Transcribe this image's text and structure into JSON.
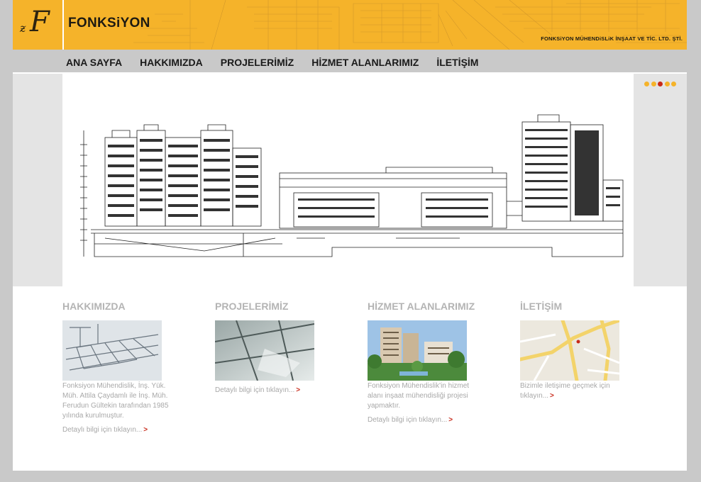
{
  "brand": {
    "name": "FONKSiYON",
    "company_name": "FONKSiYON MÜHENDiSLiK İNŞAAT VE TİC. LTD. ŞTİ."
  },
  "nav": {
    "items": [
      "ANA SAYFA",
      "HAKKIMIZDA",
      "PROJELERİMİZ",
      "HİZMET ALANLARIMIZ",
      "İLETİŞİM"
    ]
  },
  "slider": {
    "dot_count": 5,
    "active_dot": 3
  },
  "sections": [
    {
      "title": "HAKKIMIZDA",
      "text": "Fonksiyon Mühendislik, İnş. Yük. Müh. Attila Çaydamlı ile İnş. Müh. Ferudun Gültekin tarafından 1985 yılında kurulmuştur.",
      "more": "Detaylı bilgi için tıklayın..."
    },
    {
      "title": "PROJELERİMİZ",
      "text": "",
      "more": "Detaylı bilgi için tıklayın..."
    },
    {
      "title": "HİZMET ALANLARIMIZ",
      "text": "Fonksiyon Mühendislik'in hizmet alanı inşaat mühendisliği projesi yapmaktır.",
      "more": "Detaylı bilgi için tıklayın..."
    },
    {
      "title": "İLETİŞİM",
      "text": "",
      "more": "Bizimle iletişime geçmek için tıklayın..."
    }
  ],
  "colors": {
    "accent": "#f5b32a",
    "active_dot": "#c82a1a",
    "page_bg": "#c9c9c9",
    "muted_text": "#a8a8a8"
  }
}
